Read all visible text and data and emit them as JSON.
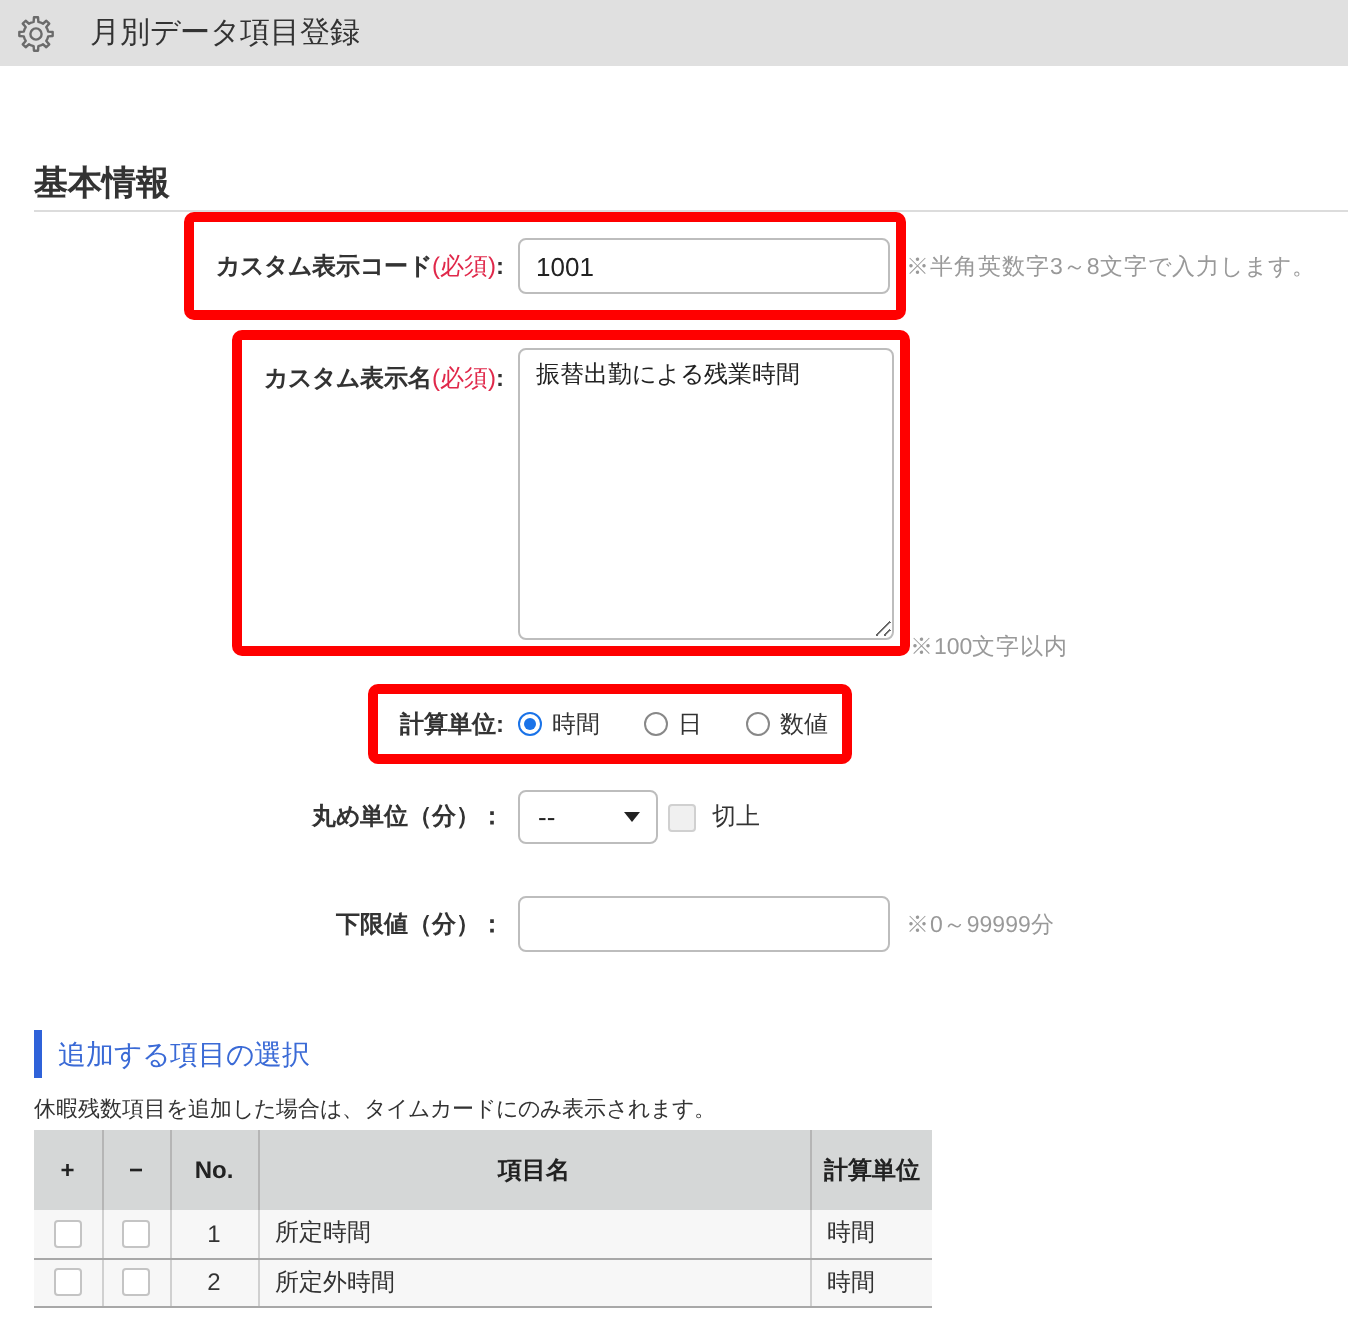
{
  "header": {
    "title": "月別データ項目登録"
  },
  "basic_info": {
    "heading": "基本情報",
    "fields": [
      {
        "kind": "text",
        "label": "カスタム表示コード",
        "required_text": "(必須)",
        "label_end": ":",
        "value": "1001",
        "hint": "※半角英数字3～8文字で入力します。",
        "highlighted": true
      },
      {
        "kind": "textarea",
        "label": "カスタム表示名",
        "required_text": "(必須)",
        "label_end": ":",
        "value": "振替出勤による残業時間",
        "hint": "※100文字以内",
        "highlighted": true
      },
      {
        "kind": "radio",
        "label": "計算単位:",
        "options": [
          {
            "label": "時間",
            "selected": true
          },
          {
            "label": "日",
            "selected": false
          },
          {
            "label": "数値",
            "selected": false
          }
        ],
        "highlighted": true
      },
      {
        "kind": "select",
        "label": "丸め単位（分）：",
        "value": "--",
        "checkbox": {
          "label": "切上",
          "checked": false,
          "disabled": true
        },
        "highlighted": false
      },
      {
        "kind": "text",
        "label": "下限値（分）：",
        "hint": "※0～99999分",
        "highlighted": false
      }
    ]
  },
  "item_selection": {
    "heading": "追加する項目の選択",
    "note": "休暇残数項目を追加した場合は、タイムカードにのみ表示されます。",
    "table": {
      "columns": [
        "+",
        "−",
        "No.",
        "項目名",
        "計算単位"
      ],
      "rows": [
        {
          "add_checked": false,
          "remove_checked": false,
          "no": "1",
          "name": "所定時間",
          "unit": "時間"
        },
        {
          "add_checked": false,
          "remove_checked": false,
          "no": "2",
          "name": "所定外時間",
          "unit": "時間"
        }
      ]
    }
  }
}
